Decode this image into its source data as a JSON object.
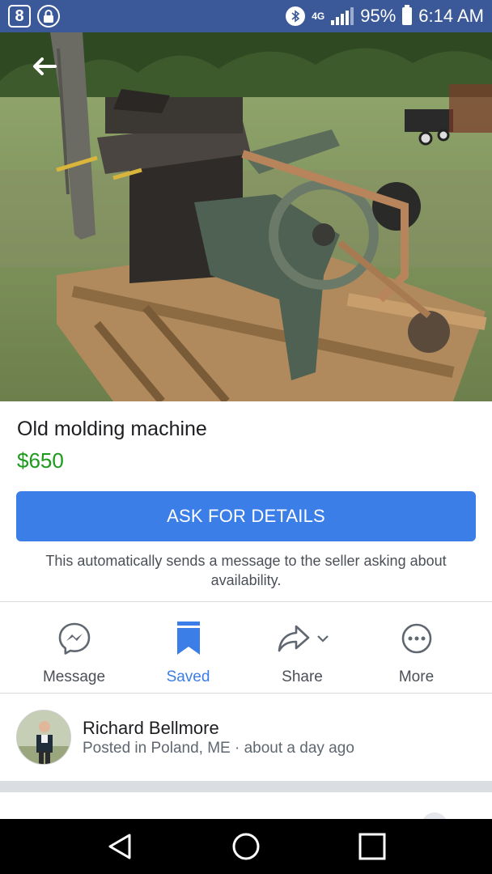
{
  "status_bar": {
    "badge_text": "8",
    "network": "4G",
    "battery": "95%",
    "time": "6:14 AM"
  },
  "hero": {
    "icon": "back-arrow-icon"
  },
  "listing": {
    "title": "Old molding machine",
    "price": "$650",
    "price_color": "#1c9a1c",
    "cta_label": "ASK FOR DETAILS",
    "cta_color": "#3b7ee8",
    "cta_note": "This automatically sends a message to the seller asking about availability."
  },
  "actions": [
    {
      "label": "Message",
      "icon": "messenger-icon",
      "active": false
    },
    {
      "label": "Saved",
      "icon": "bookmark-icon",
      "active": true
    },
    {
      "label": "Share",
      "icon": "share-arrow-icon",
      "active": false
    },
    {
      "label": "More",
      "icon": "more-dots-icon",
      "active": false
    }
  ],
  "seller": {
    "name": "Richard Bellmore",
    "meta": "Posted in Poland, ME · about a day ago"
  },
  "nav": {
    "back": "nav-back-icon",
    "home": "nav-home-icon",
    "recents": "nav-recents-icon"
  }
}
